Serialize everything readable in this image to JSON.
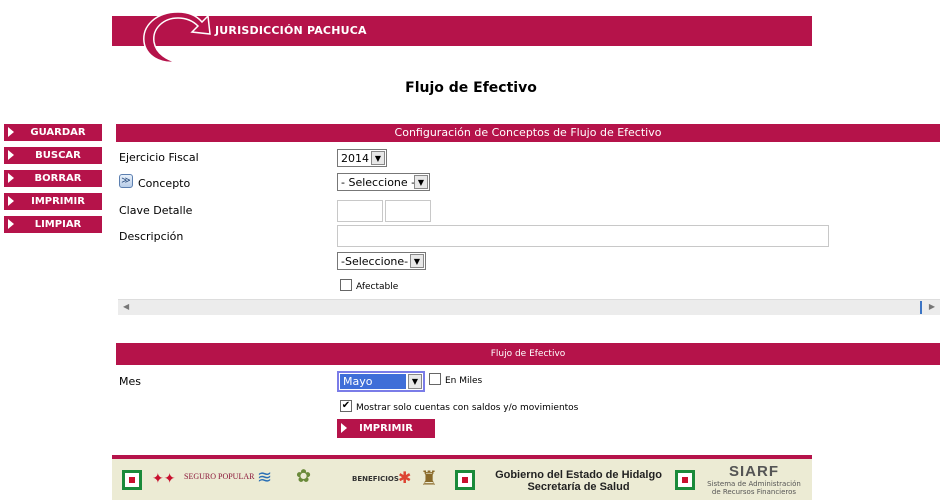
{
  "header": {
    "title": "JURISDICCIÓN PACHUCA"
  },
  "page": {
    "title": "Flujo de Efectivo"
  },
  "sidebar": {
    "buttons": [
      {
        "label": "GUARDAR"
      },
      {
        "label": "BUSCAR"
      },
      {
        "label": "BORRAR"
      },
      {
        "label": "IMPRIMIR"
      },
      {
        "label": "LIMPIAR"
      }
    ]
  },
  "config_section": {
    "title": "Configuración de Conceptos de Flujo de Efectivo",
    "ejercicio_label": "Ejercicio Fiscal",
    "ejercicio_value": "2014",
    "concepto_label": "Concepto",
    "concepto_value": "- Seleccione -",
    "clave_label": "Clave Detalle",
    "clave_value_1": "",
    "clave_value_2": "",
    "descripcion_label": "Descripción",
    "descripcion_value": "",
    "select2_value": "-Seleccione-",
    "afectable_label": "Afectable",
    "afectable_checked": false
  },
  "flujo_section": {
    "title": "Flujo de Efectivo",
    "mes_label": "Mes",
    "mes_value": "Mayo",
    "en_miles_label": "En Miles",
    "en_miles_checked": false,
    "mostrar_label": "Mostrar solo cuentas con saldos y/o movimientos",
    "mostrar_checked": true,
    "print_label": "IMPRIMIR"
  },
  "footer": {
    "seguro_popular": "SEGURO POPULAR",
    "beneficios": "BENEFICIOS",
    "gov_line1": "Gobierno del Estado de Hidalgo",
    "gov_line2": "Secretaría de Salud",
    "siarf": "SIARF",
    "siarf_sub": "Sistema de Administración de Recursos Financieros"
  },
  "colors": {
    "accent": "#b5134a",
    "footer_bg": "#ecebd4",
    "selection": "#3f6ed8"
  }
}
